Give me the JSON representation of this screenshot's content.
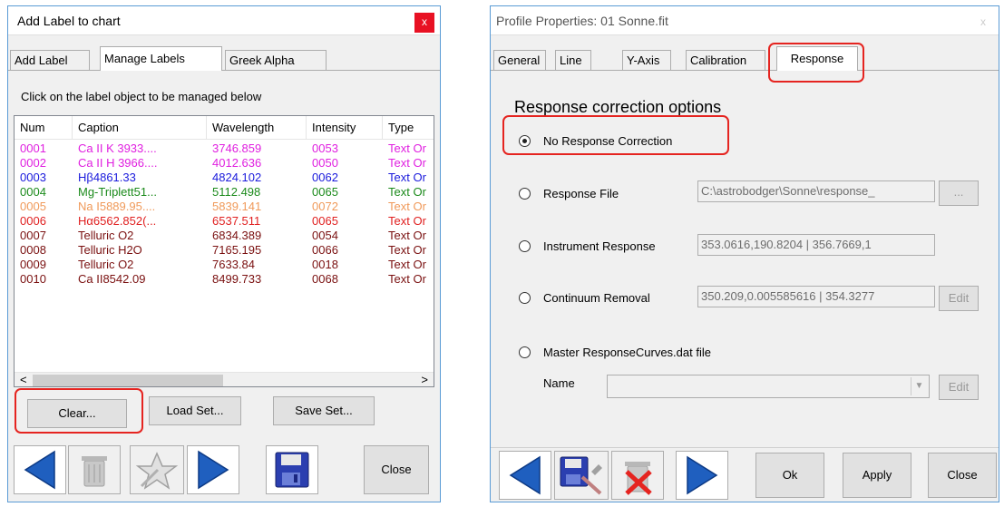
{
  "dialog1": {
    "title": "Add Label to chart",
    "close_glyph": "x",
    "tabs": [
      "Add Label",
      "Manage Labels",
      "Greek Alpha"
    ],
    "instruction": "Click on the label object to be managed below",
    "columns": [
      "Num",
      "Caption",
      "Wavelength",
      "Intensity",
      "Type"
    ],
    "rows": [
      {
        "num": "0001",
        "caption": "Ca II K 3933....",
        "wavelength": "3746.859",
        "intensity": "0053",
        "type": "Text Or",
        "color": "#e020e0"
      },
      {
        "num": "0002",
        "caption": "Ca II H 3966....",
        "wavelength": "4012.636",
        "intensity": "0050",
        "type": "Text Or",
        "color": "#e020e0"
      },
      {
        "num": "0003",
        "caption": "Hβ4861.33",
        "wavelength": "4824.102",
        "intensity": "0062",
        "type": "Text Or",
        "color": "#1a1adc"
      },
      {
        "num": "0004",
        "caption": "Mg-Triplett51...",
        "wavelength": "5112.498",
        "intensity": "0065",
        "type": "Text Or",
        "color": "#1b8a1b"
      },
      {
        "num": "0005",
        "caption": "Na I5889.95....",
        "wavelength": "5839.141",
        "intensity": "0072",
        "type": "Text Or",
        "color": "#f09a5a"
      },
      {
        "num": "0006",
        "caption": "Hα6562.852(...",
        "wavelength": "6537.511",
        "intensity": "0065",
        "type": "Text Or",
        "color": "#e02020"
      },
      {
        "num": "0007",
        "caption": "Telluric O2",
        "wavelength": "6834.389",
        "intensity": "0054",
        "type": "Text Or",
        "color": "#7a1010"
      },
      {
        "num": "0008",
        "caption": "Telluric H2O",
        "wavelength": "7165.195",
        "intensity": "0066",
        "type": "Text Or",
        "color": "#7a1010"
      },
      {
        "num": "0009",
        "caption": "Telluric O2",
        "wavelength": "7633.84",
        "intensity": "0018",
        "type": "Text Or",
        "color": "#7a1010"
      },
      {
        "num": "0010",
        "caption": "Ca II8542.09",
        "wavelength": "8499.733",
        "intensity": "0068",
        "type": "Text Or",
        "color": "#7a1010"
      }
    ],
    "buttons": {
      "clear": "Clear...",
      "load": "Load Set...",
      "save": "Save Set...",
      "close": "Close"
    },
    "scroll_left": "<",
    "scroll_right": ">"
  },
  "dialog2": {
    "title": "Profile Properties: 01 Sonne.fit",
    "close_glyph": "x",
    "tabs": [
      "General",
      "Line",
      "Y-Axis",
      "Calibration",
      "Response"
    ],
    "heading": "Response correction options",
    "options": {
      "none": "No Response Correction",
      "file": "Response File",
      "instrument": "Instrument Response",
      "continuum": "Continuum Removal",
      "master": "Master ResponseCurves.dat file"
    },
    "values": {
      "file": "C:\\astrobodger\\Sonne\\response_",
      "instrument": "353.0616,190.8204 | 356.7669,1",
      "continuum": "350.209,0.005585616 | 354.3277"
    },
    "name_label": "Name",
    "browse": "...",
    "edit": "Edit",
    "buttons": {
      "ok": "Ok",
      "apply": "Apply",
      "close": "Close"
    }
  },
  "colors": {
    "highlight": "#e52420",
    "arrow_blue": "#1f5fbf",
    "disk_blue": "#2b3fb0"
  },
  "icons": [
    "left-arrow-icon",
    "trash-icon",
    "wizard-icon",
    "right-arrow-icon",
    "floppy-disk-icon",
    "delete-icon"
  ]
}
